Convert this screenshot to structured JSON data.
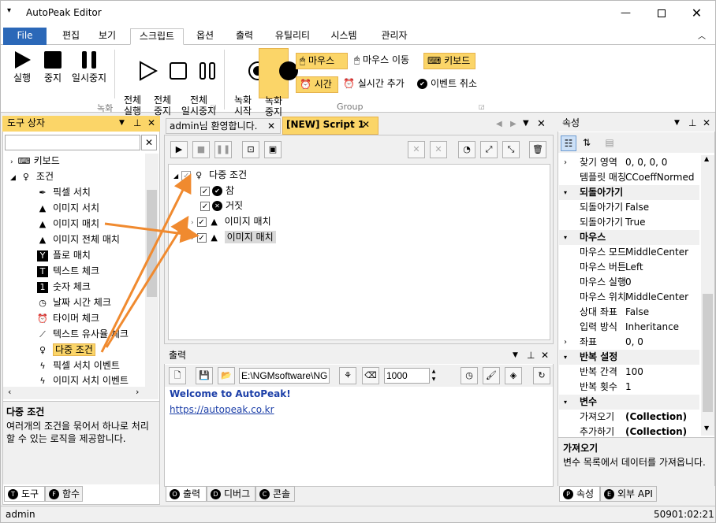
{
  "window": {
    "title": "AutoPeak Editor",
    "min_icon": "minimize-icon",
    "max_icon": "maximize-icon",
    "close_icon": "close-icon"
  },
  "menu": {
    "file": "File",
    "items": [
      "편집",
      "보기",
      "스크립트",
      "옵션",
      "출력",
      "유틸리티",
      "시스템",
      "관리자"
    ]
  },
  "ribbon": {
    "buttons": {
      "run": "실행",
      "stop": "중지",
      "pause": "일시중지",
      "run_all": "전체\n실행",
      "stop_all": "전체\n중지",
      "pause_all": "전체\n일시중지",
      "rec_start": "녹화\n시작",
      "rec_stop": "녹화\n중지"
    },
    "group_record": "녹화",
    "group_group": "Group",
    "small": {
      "mouse": "마우스",
      "mouse_move": "마우스 이동",
      "keyboard": "키보드",
      "time": "시간",
      "realtime_add": "실시간 추가",
      "event_cancel": "이벤트 취소"
    }
  },
  "toolbox": {
    "title": "도구 상자",
    "search_value": "",
    "items": [
      "키보드",
      "조건",
      "픽셀 서치",
      "이미지 서치",
      "이미지 매치",
      "이미지 전체 매치",
      "플로 매치",
      "텍스트 체크",
      "숫자 체크",
      "날짜 시간 체크",
      "타이머 체크",
      "텍스트 유사율 체크",
      "다중 조건",
      "픽셀 서치 이벤트",
      "이미지 서치 이벤트"
    ],
    "desc_title": "다중 조건",
    "desc_text": "여러개의 조건을 묶어서 하나로 처리할 수 있는 로직을 제공합니다.",
    "tabs": [
      "도구",
      "함수"
    ]
  },
  "editor": {
    "tabs": [
      "admin님 환영합니다.",
      "[NEW] Script 1"
    ],
    "tree": {
      "root": "다중 조건",
      "children": [
        "참",
        "거짓",
        "이미지 매치",
        "이미지 매치"
      ]
    }
  },
  "output": {
    "title": "출력",
    "path": "E:\\NGMsoftware\\NG",
    "delay": "1000",
    "lines": [
      "Welcome to AutoPeak!",
      "https://autopeak.co.kr"
    ],
    "tabs": [
      "출력",
      "디버그",
      "콘솔"
    ]
  },
  "properties": {
    "title": "속성",
    "rows": [
      {
        "type": "row",
        "k": "찾기 영역",
        "v": "0, 0, 0, 0",
        "exp": "›"
      },
      {
        "type": "row",
        "k": "템플릿 매칭",
        "v": "CCoeffNormed",
        "exp": ""
      },
      {
        "type": "cat",
        "k": "되돌아가기"
      },
      {
        "type": "row",
        "k": "되돌아가기",
        "v": "False",
        "exp": ""
      },
      {
        "type": "row",
        "k": "되돌아가기",
        "v": "True",
        "exp": ""
      },
      {
        "type": "cat",
        "k": "마우스"
      },
      {
        "type": "row",
        "k": "마우스 모드",
        "v": "MiddleCenter",
        "exp": ""
      },
      {
        "type": "row",
        "k": "마우스 버튼",
        "v": "Left",
        "exp": ""
      },
      {
        "type": "row",
        "k": "마우스 실행",
        "v": "0",
        "exp": ""
      },
      {
        "type": "row",
        "k": "마우스 위치",
        "v": "MiddleCenter",
        "exp": ""
      },
      {
        "type": "row",
        "k": "상대 좌표",
        "v": "False",
        "exp": ""
      },
      {
        "type": "row",
        "k": "입력 방식",
        "v": "Inheritance",
        "exp": ""
      },
      {
        "type": "row",
        "k": "좌표",
        "v": "0, 0",
        "exp": "›"
      },
      {
        "type": "cat",
        "k": "반복 설정"
      },
      {
        "type": "row",
        "k": "반복 간격",
        "v": "100",
        "exp": ""
      },
      {
        "type": "row",
        "k": "반복 횟수",
        "v": "1",
        "exp": ""
      },
      {
        "type": "cat",
        "k": "변수"
      },
      {
        "type": "row",
        "k": "가져오기",
        "v": "(Collection)",
        "exp": ""
      },
      {
        "type": "row",
        "k": "추가하기",
        "v": "(Collection)",
        "exp": ""
      }
    ],
    "desc_title": "가져오기",
    "desc_text": "변수 목록에서 데이터를 가져옵니다.",
    "tabs": [
      "속성",
      "외부 API"
    ]
  },
  "status": {
    "user": "admin",
    "time": "50901:02:21"
  },
  "colors": {
    "accent": "#2b68b8",
    "highlight": "#fbd568",
    "arrow": "#f08a2f"
  }
}
